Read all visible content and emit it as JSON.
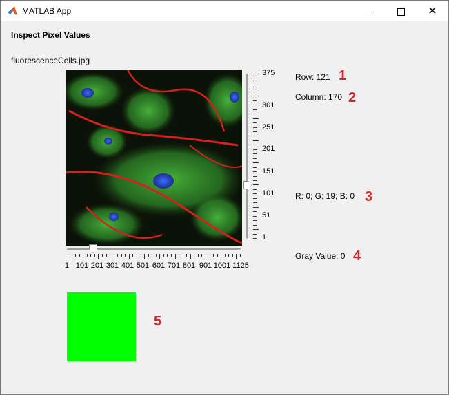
{
  "window": {
    "title": "MATLAB App"
  },
  "header": {
    "title": "Inspect Pixel Values"
  },
  "image": {
    "filename": "fluorescenceCells.jpg"
  },
  "vertical_slider": {
    "ticks": [
      "375",
      "301",
      "251",
      "201",
      "151",
      "101",
      "51",
      "1"
    ]
  },
  "horizontal_slider": {
    "ticks": [
      "1",
      "101",
      "201",
      "301",
      "401",
      "501",
      "601",
      "701",
      "801",
      "901",
      "1001",
      "1125"
    ]
  },
  "readouts": {
    "row": "Row: 121",
    "column": "Column: 170",
    "rgb": "R: 0; G: 19; B: 0",
    "gray": "Gray Value: 0"
  },
  "swatch": {
    "color": "#00ff00"
  },
  "markers": [
    "1",
    "2",
    "3",
    "4",
    "5"
  ],
  "colors": {
    "swatch": "#00ff00",
    "markers": "#d0282e",
    "titlebar": "#ffffff",
    "background": "#f0f0f0"
  },
  "icons": {
    "app": "matlab-logo-icon",
    "minimize": "minimize-icon",
    "maximize": "maximize-icon",
    "close": "close-icon"
  }
}
